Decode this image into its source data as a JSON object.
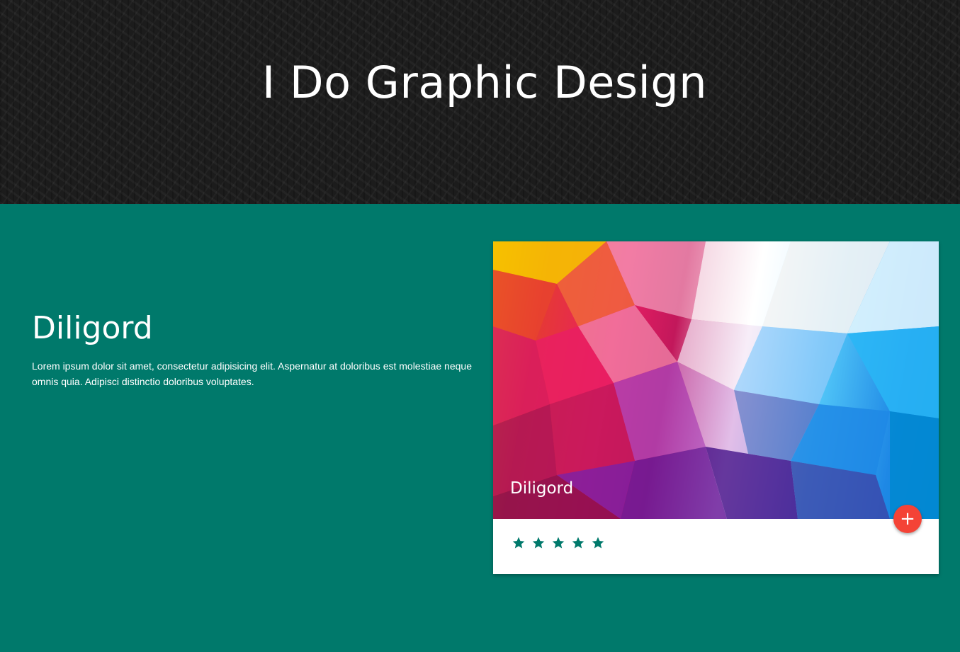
{
  "hero": {
    "title": "I Do Graphic Design"
  },
  "section": {
    "title": "Diligord",
    "text": "Lorem ipsum dolor sit amet, consectetur adipisicing elit. Aspernatur at doloribus est molestiae neque omnis quia. Adipisci distinctio doloribus voluptates."
  },
  "card": {
    "image_title": "Diligord",
    "fab_icon": "plus-icon",
    "fab_symbol": "+",
    "rating": 5,
    "rating_max": 5,
    "star_color": "#00796b",
    "fab_color": "#f44336"
  },
  "colors": {
    "accent": "#00796b",
    "hero_bg": "#1c1c1c"
  }
}
